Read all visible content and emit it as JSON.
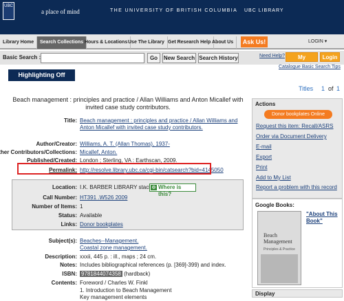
{
  "header": {
    "crest_text": "UBC",
    "tagline": "a place of mind",
    "university": "THE UNIVERSITY OF BRITISH COLUMBIA",
    "library": "UBC LIBRARY"
  },
  "nav": {
    "items": [
      "Library Home",
      "Search Collections",
      "Hours & Locations",
      "Use The Library",
      "Get Research Help",
      "About Us"
    ],
    "ask_us": "Ask Us!",
    "login": "LOGIN ▾"
  },
  "search": {
    "label": "Basic Search :",
    "value": "",
    "go": "Go",
    "new_search": "New Search",
    "history": "Search History",
    "need_help": "Need Help?",
    "my_account": "My Account",
    "login_button": "Login",
    "tips": "Catalogue Basic Search Tips"
  },
  "highlighting": "Highlighting Off",
  "pagination": {
    "titles": "Titles",
    "current": "1",
    "of": "of",
    "total": "1"
  },
  "record": {
    "title": "Beach management : principles and practice / Allan Williams and Anton Micallef with invited case study contributors.",
    "fields": {
      "title_label": "Title:",
      "title_value": "Beach management : principles and practice / Allan Williams and Anton Micallef with invited case study contributors.",
      "author_label": "Author/Creator:",
      "author_value": "Williams, A. T. (Allan Thomas), 1937-",
      "other_label": "Other Contributors/Collections:",
      "other_value": "Micallef, Anton.",
      "published_label": "Published/Created:",
      "published_value": "London ; Sterling, VA : Earthscan, 2009.",
      "permalink_label": "Permalink:",
      "permalink_value": "http://resolve.library.ubc.ca/cgi-bin/catsearch?bid=4145050"
    },
    "holdings": {
      "location_label": "Location:",
      "location_value": "I.K. BARBER LIBRARY stacks",
      "where_is_this": "Where is this?",
      "call_label": "Call Number:",
      "call_value": "HT391 .W526 2009",
      "items_label": "Number of Items:",
      "items_value": "1",
      "status_label": "Status:",
      "status_value": "Available",
      "links_label": "Links:",
      "links_value": "Donor bookplates"
    },
    "more": {
      "subjects_label": "Subject(s):",
      "subject_1": "Beaches--Management.",
      "subject_2": "Coastal zone management.",
      "description_label": "Description:",
      "description_value": "xxxii, 445 p. : ill., maps ; 24 cm.",
      "notes_label": "Notes:",
      "notes_value": "Includes bibliographical references (p. [369]-399) and index.",
      "isbn_label": "ISBN:",
      "isbn_value": "9781844074358",
      "isbn_suffix": "(hardback)",
      "contents_label": "Contents:",
      "contents_1": "Foreword / Charles W. Finkl",
      "contents_2": "1. Introduction to Beach Management",
      "contents_3": "Key management elements"
    }
  },
  "actions": {
    "heading": "Actions",
    "bookplates_button": "Donor bookplates Online",
    "items": [
      "Request this item: Recall/ASRS",
      "Order via Document Delivery",
      "E-mail",
      "Export",
      "Print",
      "Add to My List",
      "Report a problem with this record"
    ]
  },
  "google_books": {
    "heading": "Google Books:",
    "link": "\"About This Book\"",
    "cover_title": "Beach Management",
    "cover_subtitle": "Principles & Practice"
  },
  "display": {
    "heading": "Display"
  }
}
